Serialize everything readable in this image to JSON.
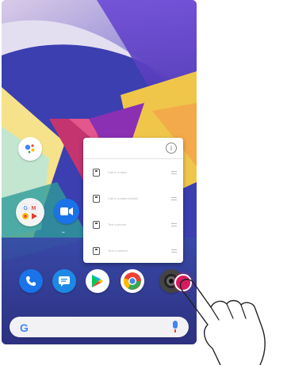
{
  "popup": {
    "info_icon": "info-icon",
    "shortcuts": [
      {
        "icon": "contact-icon",
        "label": "Call a contact"
      },
      {
        "icon": "contact-card-icon",
        "label": "Call a contact (redial)"
      },
      {
        "icon": "contact-icon",
        "label": "Text a phone"
      },
      {
        "icon": "contact-card-icon",
        "label": "Text a contact"
      }
    ]
  },
  "dock": {
    "apps": [
      {
        "name": "Phone",
        "icon": "phone-icon"
      },
      {
        "name": "Messages",
        "icon": "messages-icon"
      },
      {
        "name": "Play Store",
        "icon": "play-store-icon"
      },
      {
        "name": "Chrome",
        "icon": "chrome-icon"
      },
      {
        "name": "Camera",
        "icon": "camera-icon"
      }
    ]
  },
  "home": {
    "assistant": {
      "icon": "google-assistant-icon"
    },
    "folder": {
      "icon": "app-folder-icon"
    },
    "duo": {
      "icon": "video-call-icon"
    }
  },
  "search_bar": {
    "logo_text": "G",
    "mic_icon": "mic-icon"
  },
  "colors": {
    "phone_blue": "#1a73e8",
    "messages_blue": "#1e88e5",
    "chrome_red": "#ea4335",
    "touch_pink": "#d81b60"
  }
}
